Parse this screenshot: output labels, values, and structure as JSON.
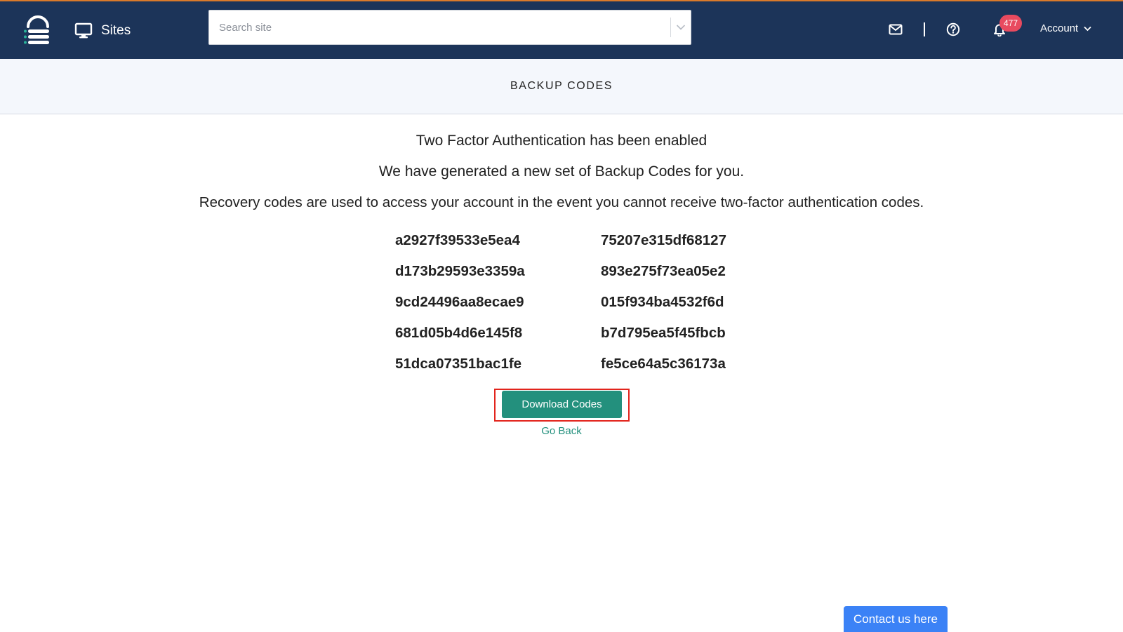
{
  "nav": {
    "sites_label": "Sites",
    "search_placeholder": "Search site",
    "notification_count": "477",
    "account_label": "Account",
    "icons": [
      "logo-icon",
      "monitor-icon",
      "chevron-down-icon",
      "mail-icon",
      "help-icon",
      "bell-icon"
    ]
  },
  "page": {
    "title": "BACKUP CODES"
  },
  "content": {
    "heading": "Two Factor Authentication has been enabled",
    "subheading": "We have generated a new set of Backup Codes for you.",
    "description": "Recovery codes are used to access your account in the event you cannot receive two-factor authentication codes.",
    "codes": [
      "a2927f39533e5ea4",
      "75207e315df68127",
      "d173b29593e3359a",
      "893e275f73ea05e2",
      "9cd24496aa8ecae9",
      "015f934ba4532f6d",
      "681d05b4d6e145f8",
      "b7d795ea5f45fbcb",
      "51dca07351bac1fe",
      "fe5ce64a5c36173a"
    ],
    "download_label": "Download Codes",
    "go_back_label": "Go Back"
  },
  "widget": {
    "contact_label": "Contact us here"
  },
  "colors": {
    "nav_bg": "#1c3459",
    "nav_top_accent": "#d97a2b",
    "primary_teal": "#23907d",
    "badge_red": "#e84a5f",
    "highlight_red": "#e2241c",
    "contact_blue": "#3b82f6"
  }
}
